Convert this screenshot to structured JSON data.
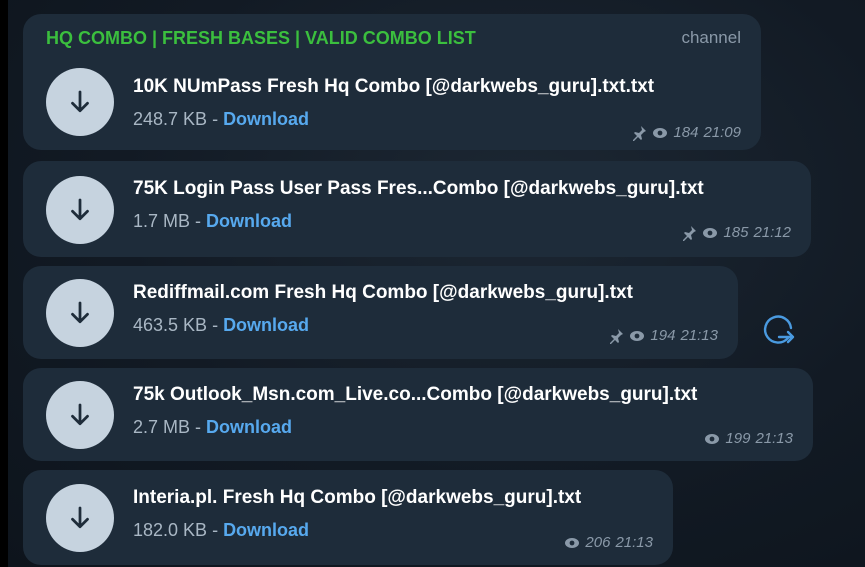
{
  "channel": {
    "title": "HQ COMBO | FRESH BASES | VALID COMBO LIST",
    "tag": "channel"
  },
  "messages": [
    {
      "file_name": "10K NUmPass Fresh Hq Combo [@darkwebs_guru].txt.txt",
      "size": "248.7 KB",
      "separator": " - ",
      "download_label": "Download",
      "pinned": true,
      "views": "184",
      "time": "21:09"
    },
    {
      "file_name": "75K Login Pass User Pass Fres...Combo [@darkwebs_guru].txt",
      "size": "1.7 MB",
      "separator": " - ",
      "download_label": "Download",
      "pinned": true,
      "views": "185",
      "time": "21:12"
    },
    {
      "file_name": "Rediffmail.com Fresh Hq Combo [@darkwebs_guru].txt",
      "size": "463.5 KB",
      "separator": " - ",
      "download_label": "Download",
      "pinned": true,
      "views": "194",
      "time": "21:13"
    },
    {
      "file_name": "75k Outlook_Msn.com_Live.co...Combo [@darkwebs_guru].txt",
      "size": "2.7 MB",
      "separator": " - ",
      "download_label": "Download",
      "pinned": false,
      "views": "199",
      "time": "21:13"
    },
    {
      "file_name": "Interia.pl. Fresh Hq Combo [@darkwebs_guru].txt",
      "size": "182.0 KB",
      "separator": " - ",
      "download_label": "Download",
      "pinned": false,
      "views": "206",
      "time": "21:13"
    }
  ],
  "icons": {
    "download": "arrow-down-icon",
    "pin": "pin-icon",
    "views": "eye-icon",
    "share": "share-icon"
  },
  "colors": {
    "bubble": "#1e2c3a",
    "channel_title": "#3bbf3e",
    "link": "#57a9ee",
    "download_circle": "#c6d3df"
  }
}
